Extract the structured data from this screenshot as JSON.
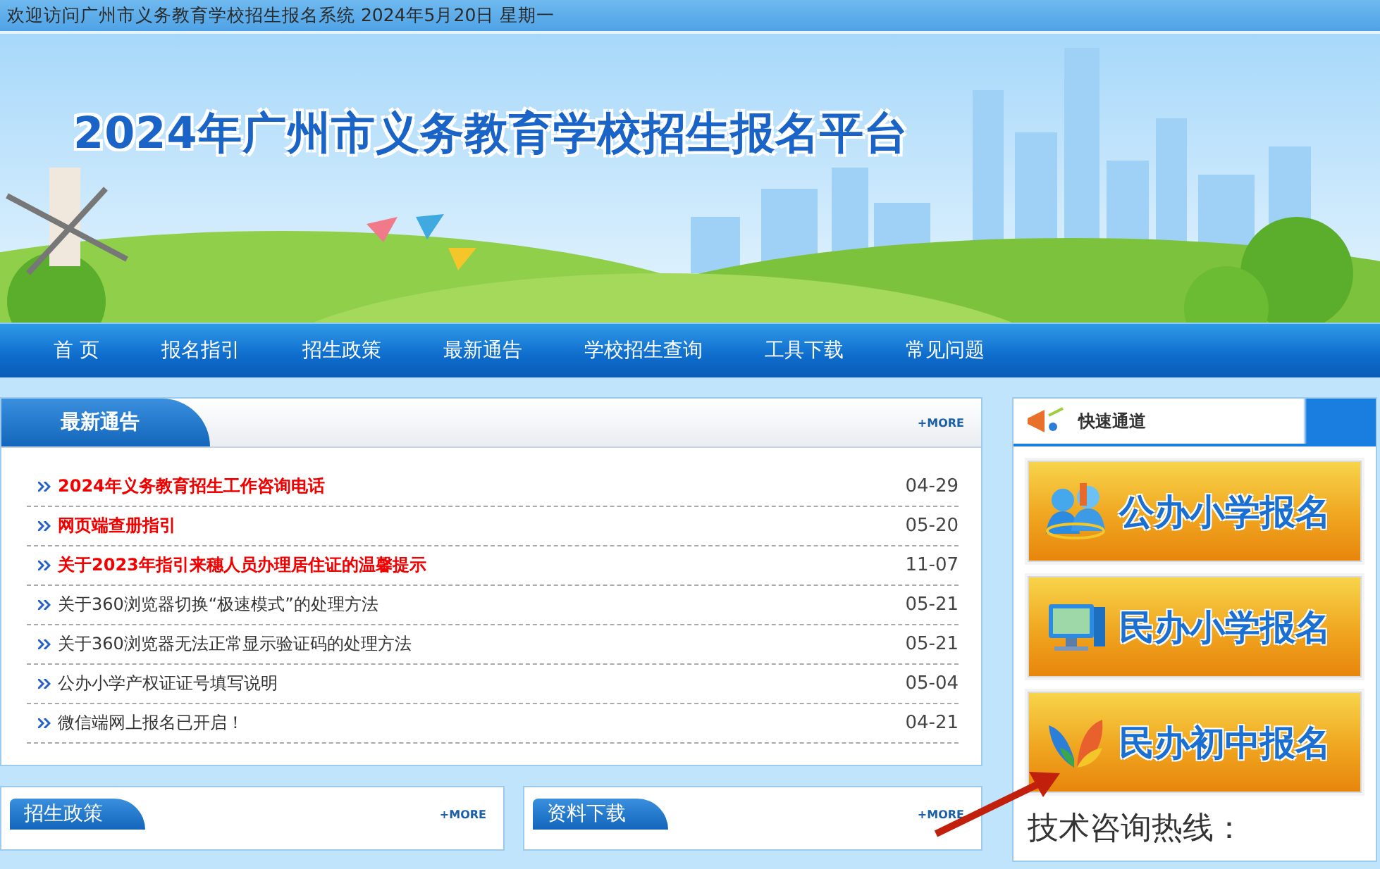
{
  "top_bar": {
    "text": "欢迎访问广州市义务教育学校招生报名系统 2024年5月20日 星期一"
  },
  "banner": {
    "title": "2024年广州市义务教育学校招生报名平台"
  },
  "nav": {
    "items": [
      {
        "label": "首 页"
      },
      {
        "label": "报名指引"
      },
      {
        "label": "招生政策"
      },
      {
        "label": "最新通告"
      },
      {
        "label": "学校招生查询"
      },
      {
        "label": "工具下载"
      },
      {
        "label": "常见问题"
      }
    ]
  },
  "news": {
    "title": "最新通告",
    "more": "+MORE",
    "items": [
      {
        "title": "2024年义务教育招生工作咨询电话",
        "date": "04-29",
        "highlight": true
      },
      {
        "title": "网页端查册指引",
        "date": "05-20",
        "highlight": true
      },
      {
        "title": "关于2023年指引来穗人员办理居住证的温馨提示",
        "date": "11-07",
        "highlight": true
      },
      {
        "title": "关于360浏览器切换“极速模式”的处理方法",
        "date": "05-21",
        "highlight": false
      },
      {
        "title": "关于360浏览器无法正常显示验证码的处理方法",
        "date": "05-21",
        "highlight": false
      },
      {
        "title": "公办小学产权证证号填写说明",
        "date": "05-04",
        "highlight": false
      },
      {
        "title": "微信端网上报名已开启！",
        "date": "04-21",
        "highlight": false
      }
    ]
  },
  "bottom_panels": [
    {
      "title": "招生政策",
      "more": "+MORE"
    },
    {
      "title": "资料下载",
      "more": "+MORE"
    }
  ],
  "quick": {
    "title": "快速通道",
    "buttons": [
      {
        "label": "公办小学报名",
        "kind": "people"
      },
      {
        "label": "民办小学报名",
        "kind": "computer"
      },
      {
        "label": "民办初中报名",
        "kind": "butterfly"
      }
    ],
    "hotline": "技术咨询热线："
  }
}
